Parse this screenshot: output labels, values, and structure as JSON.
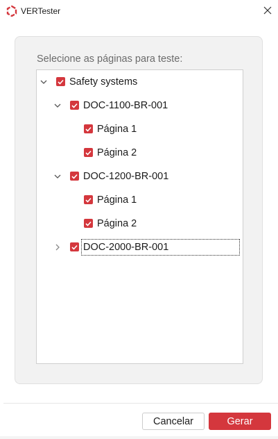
{
  "window": {
    "title": "VERTester",
    "brand_color": "#d4373d",
    "icons": {
      "logo": "vertester-logo-icon",
      "close": "close-icon"
    }
  },
  "panel": {
    "label": "Selecione as páginas para teste:"
  },
  "tree": {
    "nodes": [
      {
        "label": "Safety systems",
        "level": 0,
        "expanded": true,
        "checked": true
      },
      {
        "label": "DOC-1100-BR-001",
        "level": 1,
        "expanded": true,
        "checked": true
      },
      {
        "label": "Página 1",
        "level": 2,
        "checked": true
      },
      {
        "label": "Página 2",
        "level": 2,
        "checked": true
      },
      {
        "label": "DOC-1200-BR-001",
        "level": 1,
        "expanded": true,
        "checked": true
      },
      {
        "label": "Página 1",
        "level": 2,
        "checked": true
      },
      {
        "label": "Página 2",
        "level": 2,
        "checked": true
      },
      {
        "label": "DOC-2000-BR-001",
        "level": 1,
        "expanded": false,
        "checked": true,
        "focused": true
      }
    ]
  },
  "footer": {
    "cancel_label": "Cancelar",
    "ok_label": "Gerar"
  }
}
